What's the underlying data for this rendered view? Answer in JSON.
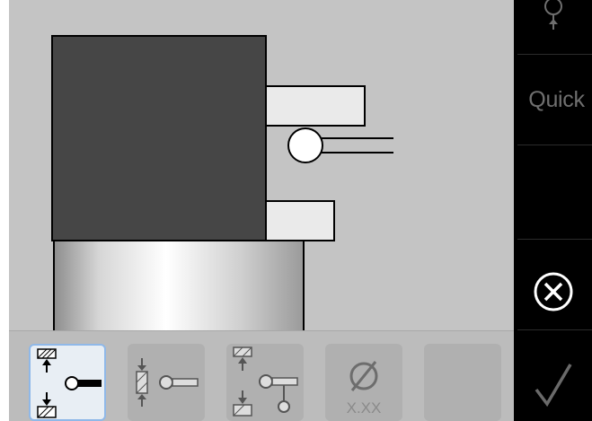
{
  "side_panel": {
    "quick_label": "Quick",
    "icons": {
      "top": "probe-tip-icon",
      "cancel": "cancel-circle-x-icon",
      "confirm": "checkmark-icon"
    }
  },
  "canvas": {
    "illustration": "workpiece-with-probe-icon"
  },
  "toolbar": {
    "tools": [
      {
        "name": "probe-groove-between-surfaces-icon",
        "selected": true
      },
      {
        "name": "probe-rib-between-surfaces-icon",
        "selected": false
      },
      {
        "name": "probe-groove-with-stylus-icon",
        "selected": false
      },
      {
        "name": "diameter-tool-icon",
        "selected": false,
        "label": "X.XX"
      },
      {
        "name": "empty-tool-slot",
        "selected": false
      }
    ]
  },
  "colors": {
    "canvas_bg": "#c4c4c4",
    "workpiece": "#464646",
    "selected_border": "#8fb8e8",
    "side_bg": "#000000"
  }
}
